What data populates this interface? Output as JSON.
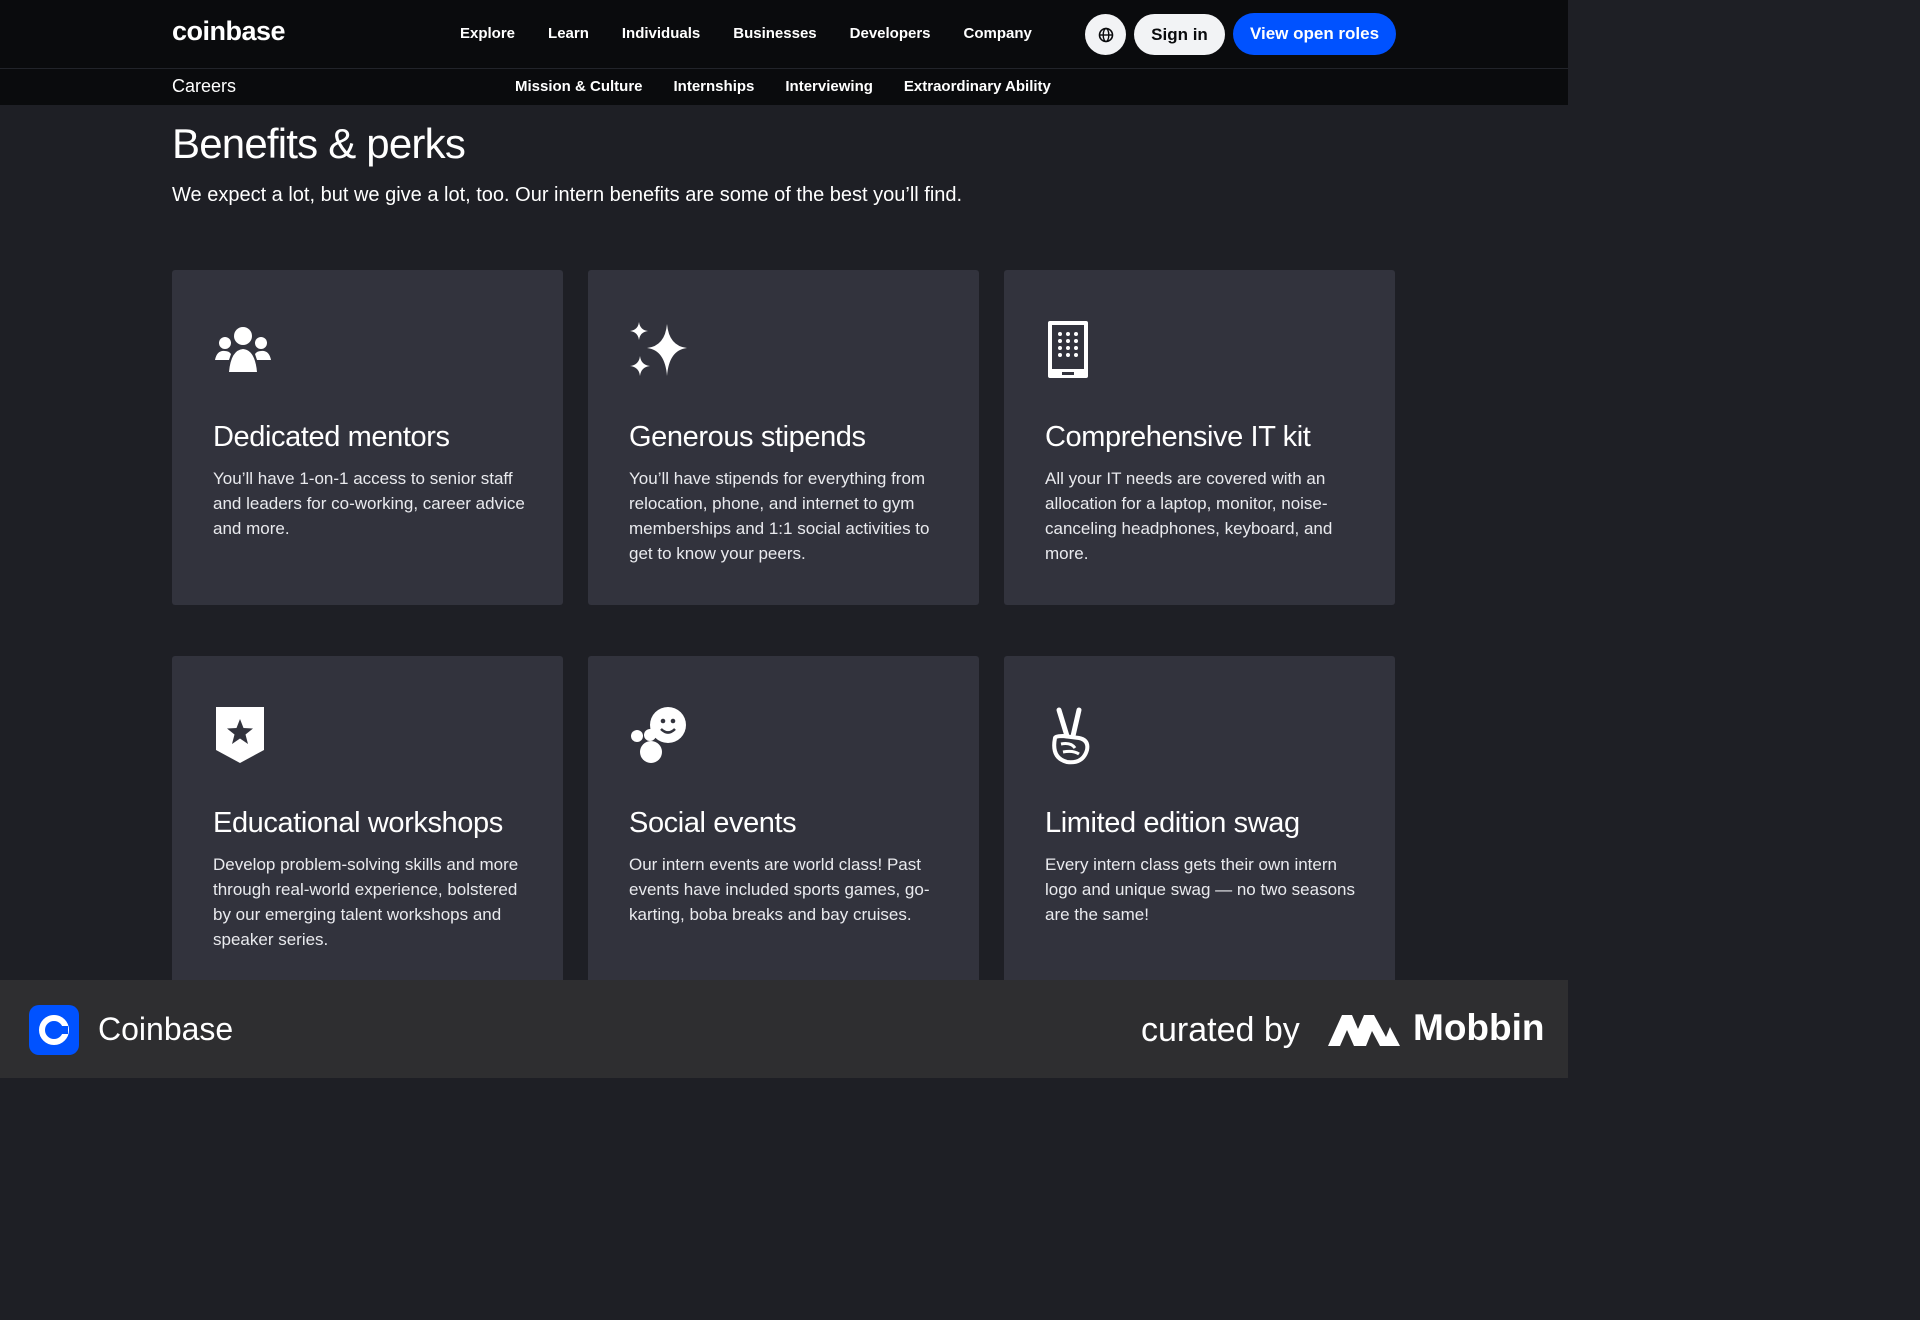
{
  "header": {
    "logo": "coinbase",
    "nav": [
      "Explore",
      "Learn",
      "Individuals",
      "Businesses",
      "Developers",
      "Company"
    ],
    "globe_icon": "globe-icon",
    "sign_in": "Sign in",
    "view_roles": "View open roles"
  },
  "subheader": {
    "section": "Careers",
    "nav": [
      "Mission & Culture",
      "Internships",
      "Interviewing",
      "Extraordinary Ability"
    ]
  },
  "benefits": {
    "title": "Benefits & perks",
    "subtitle": "We expect a lot, but we give a lot, too. Our intern benefits are some of the best you’ll find.",
    "cards": [
      {
        "icon": "people-group-icon",
        "title": "Dedicated mentors",
        "text": "You’ll have 1-on-1 access to senior staff and leaders for co-working, career advice and more."
      },
      {
        "icon": "sparkle-icon",
        "title": "Generous stipends",
        "text": "You’ll have stipends for everything from relocation, phone, and internet to gym memberships and 1:1 social activities to get to know your peers."
      },
      {
        "icon": "device-keypad-icon",
        "title": "Comprehensive IT kit",
        "text": "All your IT needs are covered with an allocation for a laptop, monitor, noise-canceling headphones, keyboard, and more."
      },
      {
        "icon": "star-badge-icon",
        "title": "Educational workshops",
        "text": "Develop problem-solving skills and more through real-world experience, bolstered by our emerging talent workshops and speaker series."
      },
      {
        "icon": "smiley-bubbles-icon",
        "title": "Social events",
        "text": "Our intern events are world class! Past events have included sports games, go-karting, boba breaks and bay cruises."
      },
      {
        "icon": "peace-hand-icon",
        "title": "Limited edition swag",
        "text": "Every intern class gets their own intern logo and unique swag — no two seasons are the same!"
      }
    ]
  },
  "footer": {
    "app_name": "Coinbase",
    "curated_by": "curated by",
    "brand": "Mobbin"
  },
  "colors": {
    "background": "#1e1f25",
    "card": "#32333d",
    "nav_bg": "#0a0b0d",
    "accent": "#0052ff",
    "footer_bg": "#2e2e30"
  }
}
